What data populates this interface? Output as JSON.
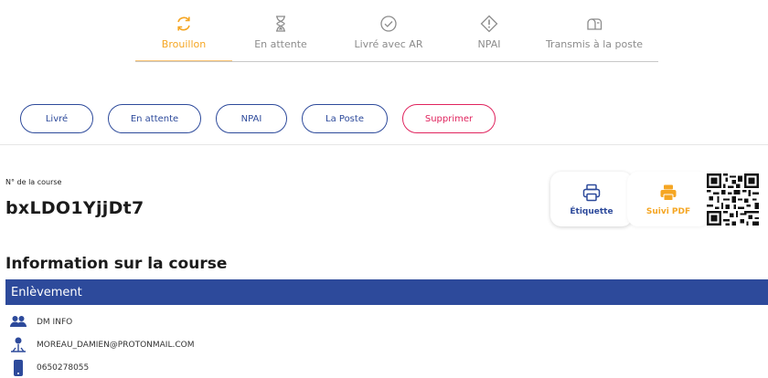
{
  "status_tabs": [
    {
      "label": "Brouillon",
      "icon": "refresh-icon",
      "active": true
    },
    {
      "label": "En attente",
      "icon": "hourglass-icon",
      "active": false
    },
    {
      "label": "Livré avec AR",
      "icon": "check-circle-icon",
      "active": false
    },
    {
      "label": "NPAI",
      "icon": "warning-diamond-icon",
      "active": false
    },
    {
      "label": "Transmis à la poste",
      "icon": "mailbox-icon",
      "active": false
    }
  ],
  "actions": {
    "livre": "Livré",
    "en_attente": "En attente",
    "npai": "NPAI",
    "la_poste": "La Poste",
    "supprimer": "Supprimer"
  },
  "course": {
    "label": "N° de la course",
    "number": "bxLDO1YjjDt7"
  },
  "cards": {
    "etiquette": "Étiquette",
    "suivi_pdf": "Suivi PDF"
  },
  "info": {
    "title": "Information sur la course",
    "band_title": "Enlèvement",
    "name": "DM INFO",
    "email": "MOREAU_DAMIEN@PROTONMAIL.COM",
    "phone": "0650278055"
  },
  "colors": {
    "accent_orange": "#f5a623",
    "primary_blue": "#2d4a9b",
    "danger_pink": "#e0245e",
    "muted_gray": "#8c8c8c"
  }
}
